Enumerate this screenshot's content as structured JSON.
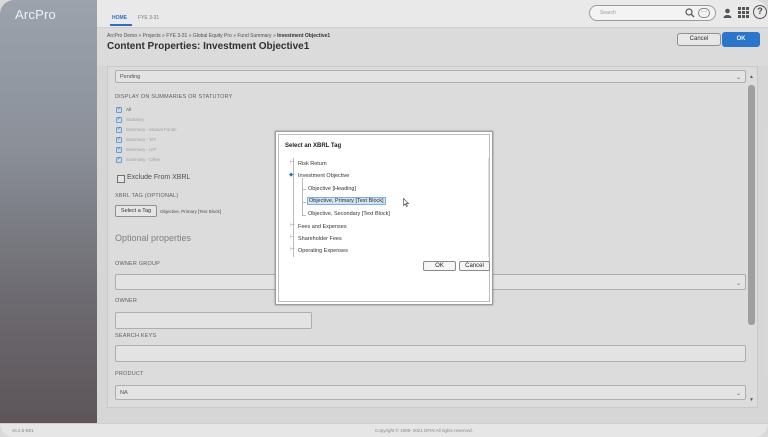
{
  "app": {
    "brand": "ArcPro"
  },
  "nav": {
    "tabs": [
      {
        "label": "HOME"
      },
      {
        "label": "FYE 3-31"
      }
    ],
    "search_placeholder": "Search",
    "more_label": "···",
    "help_label": "?"
  },
  "header": {
    "breadcrumb": [
      "ArcPro Demo",
      "Projects",
      "FYE 3-31",
      "Global Equity Pro",
      "Fund Summary",
      "Investment Objective1"
    ],
    "breadcrumb_sep": "»",
    "title": "Content Properties: Investment Objective1",
    "cancel_label": "Cancel",
    "ok_label": "OK"
  },
  "form": {
    "status_value": "Pending",
    "display_label": "DISPLAY ON SUMMARIES OR STATUTORY",
    "display_options": [
      {
        "label": "All",
        "checked": true
      },
      {
        "label": "Statutory",
        "checked": true
      },
      {
        "label": "Summary - Mutual Funds",
        "checked": true
      },
      {
        "label": "Summary - VIT",
        "checked": true
      },
      {
        "label": "Summary - UIT",
        "checked": true
      },
      {
        "label": "Summary - Other",
        "checked": true
      }
    ],
    "exclude_label": "Exclude From XBRL",
    "xbrl_label": "XBRL TAG (OPTIONAL)",
    "select_tag_label": "Select a Tag",
    "xbrl_value": "Objective, Primary [Text Block]",
    "optional_heading": "Optional properties",
    "owner_group_label": "OWNER GROUP",
    "owner_label": "OWNER",
    "search_keys_label": "SEARCH KEYS",
    "product_label": "PRODUCT",
    "product_value": "NA"
  },
  "dialog": {
    "title": "Select an XBRL Tag",
    "tree": [
      {
        "label": "Risk Return",
        "level": 0
      },
      {
        "label": "Investment Objective",
        "level": 0,
        "expanded": true
      },
      {
        "label": "Objective [Heading]",
        "level": 1
      },
      {
        "label": "Objective, Primary [Text Block]",
        "level": 1,
        "selected": true
      },
      {
        "label": "Objective, Secondary [Text Block]",
        "level": 1
      },
      {
        "label": "Fees and Expenses",
        "level": 0
      },
      {
        "label": "Shareholder Fees",
        "level": 0
      },
      {
        "label": "Operating Expenses",
        "level": 0
      }
    ],
    "ok_label": "OK",
    "cancel_label": "Cancel"
  },
  "footer": {
    "version": "v6.2.8-B01",
    "copyright": "Copyright © 1998- 2021 DFIN All rights reserved."
  },
  "colors": {
    "accent": "#2e7ed7",
    "selection": "#cfe3f7"
  }
}
